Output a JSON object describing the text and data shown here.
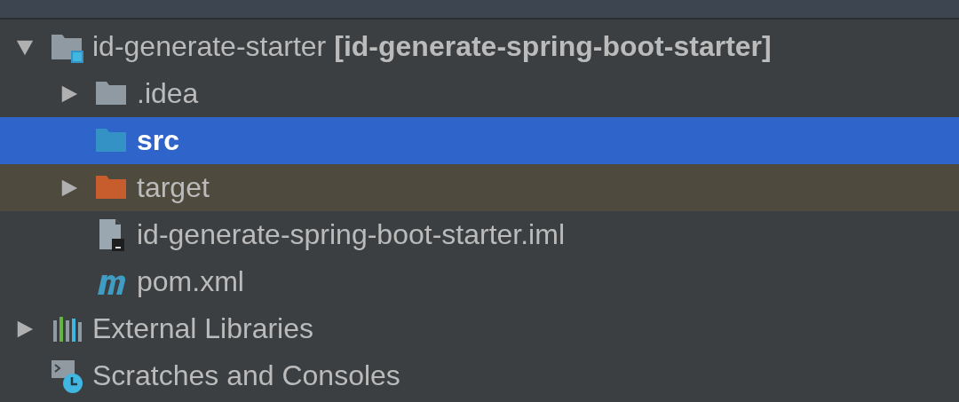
{
  "tree": [
    {
      "label": "id-generate-starter",
      "suffix": "[id-generate-spring-boot-starter]",
      "kind": "module",
      "expanded": true,
      "selected": false,
      "children": [
        {
          "label": ".idea",
          "kind": "folder",
          "expanded": false,
          "selected": false
        },
        {
          "label": "src",
          "kind": "source-folder",
          "selected": true
        },
        {
          "label": "target",
          "kind": "excluded-folder",
          "expanded": false,
          "selected": false
        },
        {
          "label": "id-generate-spring-boot-starter.iml",
          "kind": "iml-file",
          "selected": false
        },
        {
          "label": "pom.xml",
          "kind": "maven-file",
          "selected": false
        }
      ]
    },
    {
      "label": "External Libraries",
      "kind": "libraries",
      "expanded": false,
      "selected": false
    },
    {
      "label": "Scratches and Consoles",
      "kind": "scratches",
      "selected": false
    }
  ]
}
